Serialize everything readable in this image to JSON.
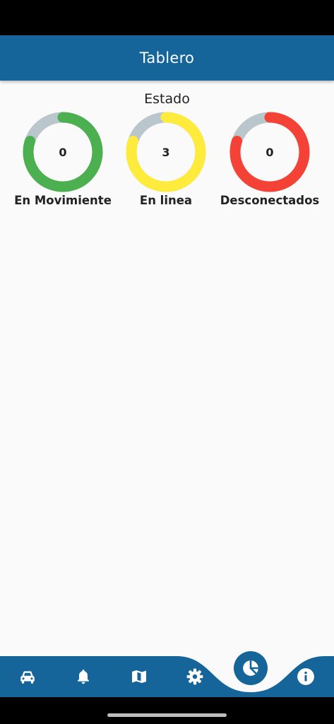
{
  "app_bar": {
    "title": "Tablero"
  },
  "dashboard": {
    "section_title": "Estado",
    "track_color": "#b9c6cc",
    "gauges": [
      {
        "label": "En Movimiente",
        "value": "0",
        "fill_fraction": 0.8,
        "color": "#4caf50"
      },
      {
        "label": "En linea",
        "value": "3",
        "fill_fraction": 0.8,
        "color": "#ffeb3b"
      },
      {
        "label": "Desconectados",
        "value": "0",
        "fill_fraction": 0.8,
        "color": "#f44336"
      }
    ]
  },
  "bottom_nav": {
    "background": "#16659a",
    "items": [
      {
        "icon": "car-icon"
      },
      {
        "icon": "bell-icon"
      },
      {
        "icon": "map-icon"
      },
      {
        "icon": "gear-icon"
      },
      {
        "icon": "pie-chart-icon",
        "active": true
      },
      {
        "icon": "info-icon"
      }
    ]
  }
}
